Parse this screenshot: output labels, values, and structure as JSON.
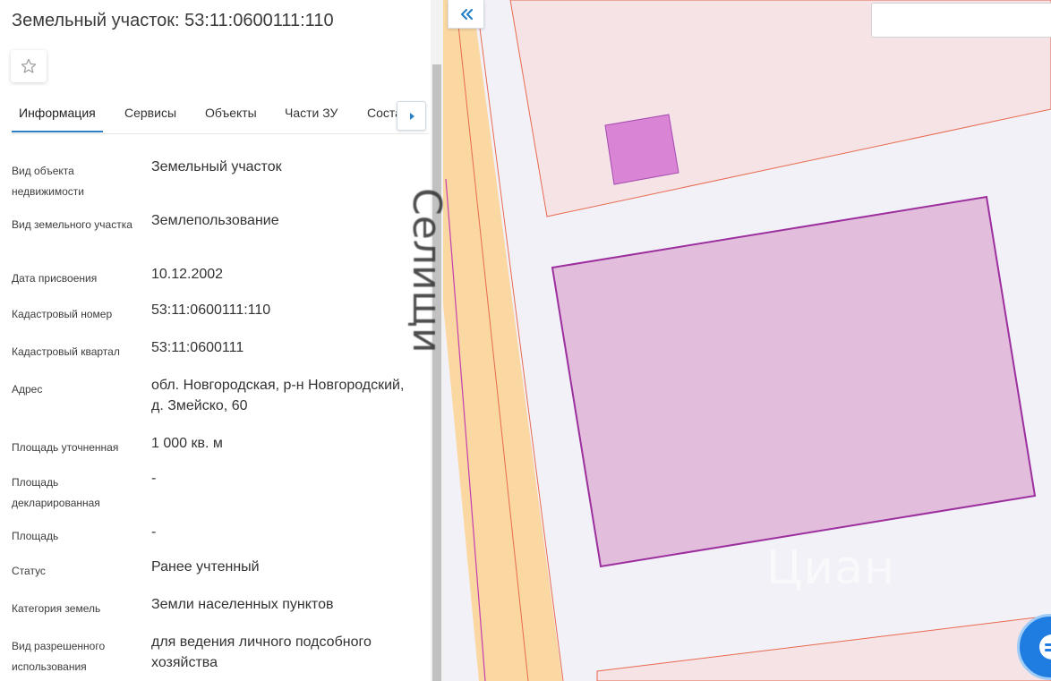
{
  "panel": {
    "title": "Земельный участок: 53:11:0600111:110",
    "tabs": [
      {
        "label": "Информация"
      },
      {
        "label": "Сервисы"
      },
      {
        "label": "Объекты"
      },
      {
        "label": "Части ЗУ"
      },
      {
        "label": "Состав"
      }
    ],
    "rows": [
      {
        "label": "Вид объекта недвижимости",
        "value": "Земельный участок"
      },
      {
        "label": "Вид земельного участка",
        "value": "Землепользование"
      },
      {
        "label": "Дата присвоения",
        "value": "10.12.2002"
      },
      {
        "label": "Кадастровый номер",
        "value": "53:11:0600111:110"
      },
      {
        "label": "Кадастровый квартал",
        "value": "53:11:0600111"
      },
      {
        "label": "Адрес",
        "value": "обл. Новгородская, р-н Новгородский, д. Змейско, 60"
      },
      {
        "label": "Площадь уточненная",
        "value": "1 000 кв. м"
      },
      {
        "label": "Площадь декларированная",
        "value": "-"
      },
      {
        "label": "Площадь",
        "value": "-"
      },
      {
        "label": "Статус",
        "value": "Ранее учтенный"
      },
      {
        "label": "Категория земель",
        "value": "Земли населенных пунктов"
      },
      {
        "label": "Вид разрешенного использования",
        "value": "для ведения личного подсобного хозяйства"
      }
    ]
  },
  "map": {
    "street_label": "Селищи",
    "watermark": "Циан",
    "search": {
      "value": "",
      "placeholder": ""
    }
  },
  "colors": {
    "accent": "#2b80c5",
    "road": "#fbd7a1",
    "parcel_fill": "#e3bedc",
    "parcel_stroke": "#9b2f9e",
    "building_fill": "#d984d5",
    "neighbor_fill": "#f5e3e6",
    "neighbor_stroke": "#e86a4f",
    "chat": "#1f7ce0"
  }
}
